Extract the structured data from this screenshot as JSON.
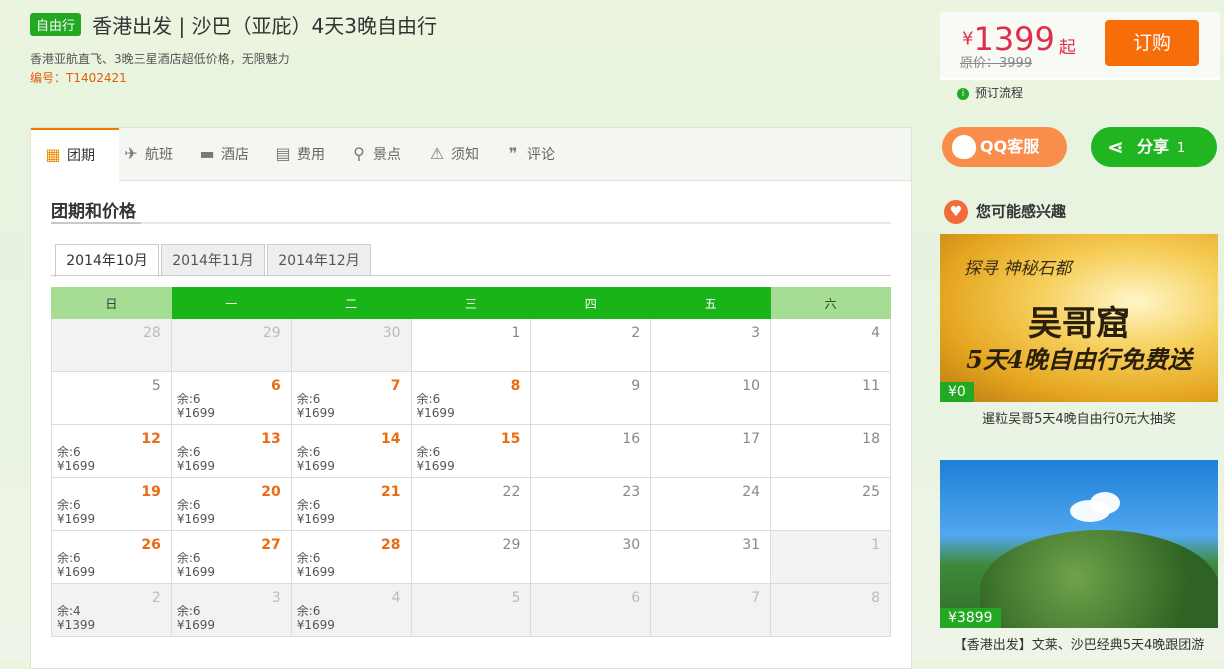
{
  "header": {
    "badge": "自由行",
    "title": "香港出发 | 沙巴（亚庇）4天3晚自由行",
    "subtitle": "香港亚航直飞、3晚三星酒店超低价格，无限魅力",
    "code": "编号：T1402421"
  },
  "price": {
    "yen": "¥",
    "value": "1399",
    "suffix": "起",
    "original": "原价：3999",
    "buy_label": "订购",
    "flow_label": "预订流程"
  },
  "side": {
    "qq_label": "QQ客服",
    "share_label": "分享",
    "share_count": "1",
    "interest_title": "您可能感兴趣",
    "cards": [
      {
        "tag": "¥0",
        "caption": "暹粒吴哥5天4晚自由行0元大抽奖",
        "img_line1": "探寻 神秘石都",
        "img_line2": "吴哥窟",
        "img_line3": "5天4晚自由行免费送"
      },
      {
        "tag": "¥3899",
        "caption": "【香港出发】文莱、沙巴经典5天4晚跟团游"
      }
    ]
  },
  "tabs": [
    {
      "label": "团期",
      "icon": "calendar-icon"
    },
    {
      "label": "航班",
      "icon": "plane-icon"
    },
    {
      "label": "酒店",
      "icon": "bed-icon"
    },
    {
      "label": "费用",
      "icon": "wallet-icon"
    },
    {
      "label": "景点",
      "icon": "pin-icon"
    },
    {
      "label": "须知",
      "icon": "warning-icon"
    },
    {
      "label": "评论",
      "icon": "comment-icon"
    }
  ],
  "section_title": "团期和价格",
  "months": [
    "2014年10月",
    "2014年11月",
    "2014年12月"
  ],
  "calendar": {
    "weekdays": [
      "日",
      "一",
      "二",
      "三",
      "四",
      "五",
      "六"
    ],
    "weeks": [
      [
        {
          "d": "28",
          "type": "grey",
          "dim": true
        },
        {
          "d": "29",
          "type": "grey",
          "dim": true
        },
        {
          "d": "30",
          "type": "grey",
          "dim": true
        },
        {
          "d": "1"
        },
        {
          "d": "2"
        },
        {
          "d": "3"
        },
        {
          "d": "4"
        }
      ],
      [
        {
          "d": "5"
        },
        {
          "d": "6",
          "type": "hot",
          "rem": "余:6",
          "price": "¥1699"
        },
        {
          "d": "7",
          "type": "hot",
          "rem": "余:6",
          "price": "¥1699"
        },
        {
          "d": "8",
          "type": "hot",
          "rem": "余:6",
          "price": "¥1699"
        },
        {
          "d": "9"
        },
        {
          "d": "10"
        },
        {
          "d": "11"
        }
      ],
      [
        {
          "d": "12",
          "type": "hot",
          "rem": "余:6",
          "price": "¥1699"
        },
        {
          "d": "13",
          "type": "hot",
          "rem": "余:6",
          "price": "¥1699"
        },
        {
          "d": "14",
          "type": "hot",
          "rem": "余:6",
          "price": "¥1699"
        },
        {
          "d": "15",
          "type": "hot",
          "rem": "余:6",
          "price": "¥1699"
        },
        {
          "d": "16"
        },
        {
          "d": "17"
        },
        {
          "d": "18"
        }
      ],
      [
        {
          "d": "19",
          "type": "hot",
          "rem": "余:6",
          "price": "¥1699"
        },
        {
          "d": "20",
          "type": "hot",
          "rem": "余:6",
          "price": "¥1699"
        },
        {
          "d": "21",
          "type": "hot",
          "rem": "余:6",
          "price": "¥1699"
        },
        {
          "d": "22"
        },
        {
          "d": "23"
        },
        {
          "d": "24"
        },
        {
          "d": "25"
        }
      ],
      [
        {
          "d": "26",
          "type": "hot",
          "rem": "余:6",
          "price": "¥1699"
        },
        {
          "d": "27",
          "type": "hot",
          "rem": "余:6",
          "price": "¥1699"
        },
        {
          "d": "28",
          "type": "hot",
          "rem": "余:6",
          "price": "¥1699"
        },
        {
          "d": "29"
        },
        {
          "d": "30"
        },
        {
          "d": "31"
        },
        {
          "d": "1",
          "type": "grey",
          "dim": true
        }
      ],
      [
        {
          "d": "2",
          "type": "grey",
          "dim": true,
          "rem": "余:4",
          "price": "¥1399"
        },
        {
          "d": "3",
          "type": "grey",
          "dim": true,
          "rem": "余:6",
          "price": "¥1699"
        },
        {
          "d": "4",
          "type": "grey",
          "dim": true,
          "rem": "余:6",
          "price": "¥1699"
        },
        {
          "d": "5",
          "type": "grey",
          "dim": true
        },
        {
          "d": "6",
          "type": "grey",
          "dim": true
        },
        {
          "d": "7",
          "type": "grey",
          "dim": true
        },
        {
          "d": "8",
          "type": "grey",
          "dim": true
        }
      ]
    ]
  }
}
